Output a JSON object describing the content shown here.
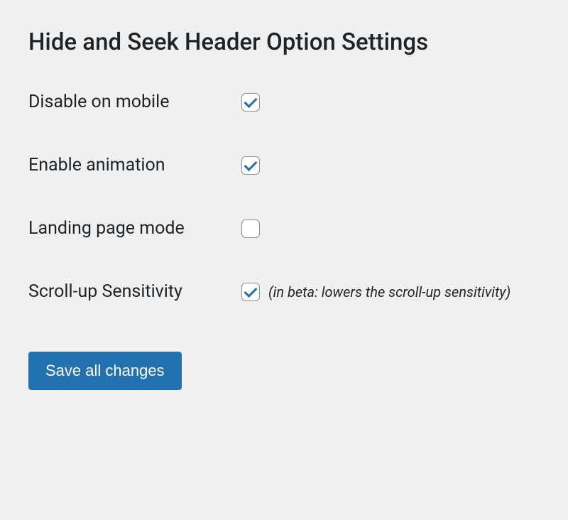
{
  "page_title": "Hide and Seek Header Option Settings",
  "options": {
    "disable_mobile": {
      "label": "Disable on mobile",
      "checked": true
    },
    "enable_animation": {
      "label": "Enable animation",
      "checked": true
    },
    "landing_page_mode": {
      "label": "Landing page mode",
      "checked": false
    },
    "scroll_up_sensitivity": {
      "label": "Scroll-up Sensitivity",
      "checked": true,
      "helper": "(in beta: lowers the scroll-up sensitivity)"
    }
  },
  "save_button_label": "Save all changes"
}
